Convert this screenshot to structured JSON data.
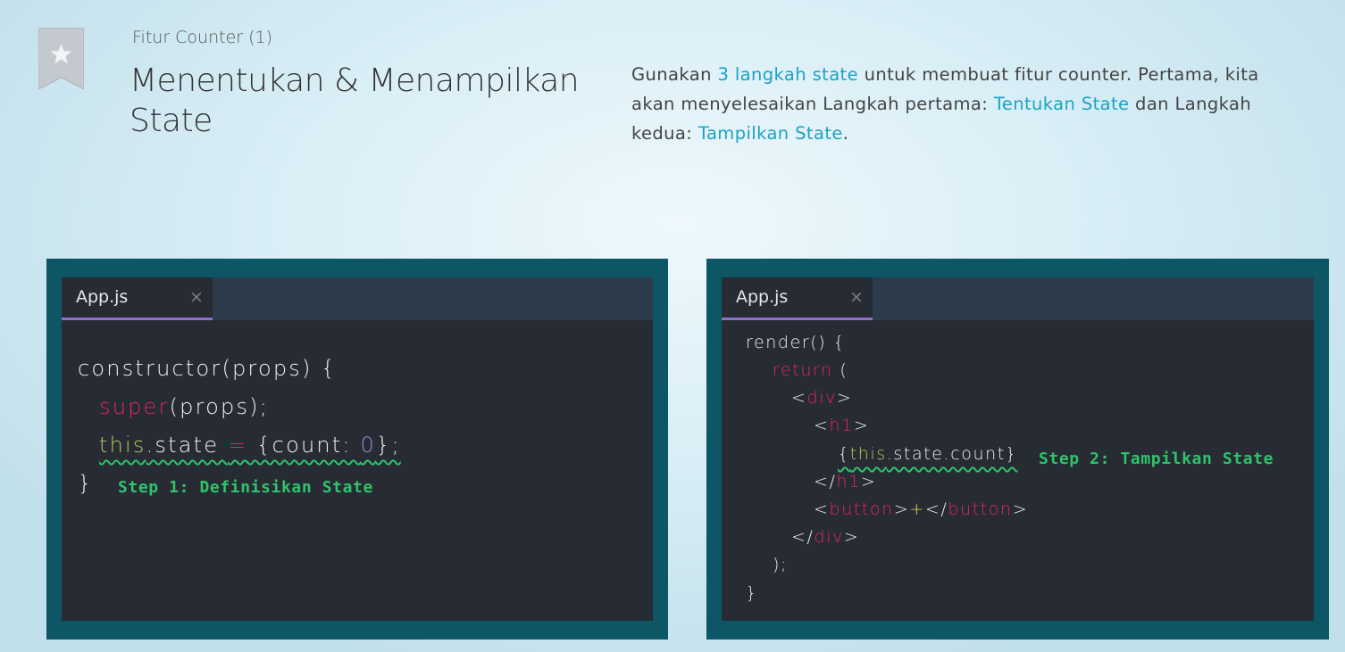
{
  "header": {
    "subtitle": "Fitur Counter (1)",
    "title": "Menentukan & Menampilkan State",
    "bookmark_icon": "star-bookmark-icon"
  },
  "description": {
    "p1": "Gunakan ",
    "link1": "3 langkah state",
    "p2": " untuk membuat fitur counter. Pertama, kita akan menyelesaikan Langkah pertama: ",
    "link2": "Tentukan State",
    "p3": " dan Langkah kedua: ",
    "link3": "Tampilkan State",
    "p4": "."
  },
  "left_editor": {
    "tab": "App.js",
    "close": "×",
    "annotation": "Step 1: Definisikan State"
  },
  "right_editor": {
    "tab": "App.js",
    "close": "×",
    "annotation": "Step 2: Tampilkan State"
  },
  "colors": {
    "panel_bg": "#0c5665",
    "editor_bg": "#272b34",
    "tabbar_bg": "#2c3c4c",
    "tab_underline": "#8d72c9",
    "keyword": "#e3265d",
    "this": "#b5c85a",
    "number": "#9b85d8",
    "annotation": "#2ec46a",
    "link": "#1aa2c7"
  }
}
